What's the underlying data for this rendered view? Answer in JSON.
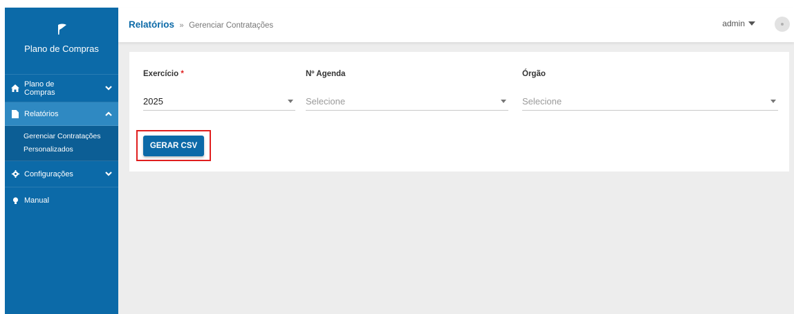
{
  "sidebar": {
    "brand_title": "Plano de Compras",
    "logo_icon": "leaf-logo",
    "items": [
      {
        "label": "Plano de Compras",
        "icon": "home-icon",
        "expanded": false
      },
      {
        "label": "Relatórios",
        "icon": "file-icon",
        "expanded": true,
        "children": [
          "Gerenciar Contratações",
          "Personalizados"
        ]
      },
      {
        "label": "Configurações",
        "icon": "gear-icon",
        "expanded": false
      },
      {
        "label": "Manual",
        "icon": "lightbulb-icon"
      }
    ]
  },
  "header": {
    "breadcrumb_main": "Relatórios",
    "breadcrumb_sep": "»",
    "breadcrumb_sub": "Gerenciar Contratações",
    "user": "admin"
  },
  "form": {
    "exercicio": {
      "label": "Exercício",
      "required_mark": "*",
      "value": "2025"
    },
    "agenda": {
      "label": "Nº Agenda",
      "placeholder": "Selecione"
    },
    "orgao": {
      "label": "Órgão",
      "placeholder": "Selecione"
    },
    "generate_button": "GERAR CSV"
  },
  "colors": {
    "sidebar_bg": "#0c6aa8",
    "sidebar_active": "#2f89c2",
    "primary": "#0c6aa8",
    "highlight_outline": "#e01e1e",
    "content_bg": "#ededed"
  }
}
